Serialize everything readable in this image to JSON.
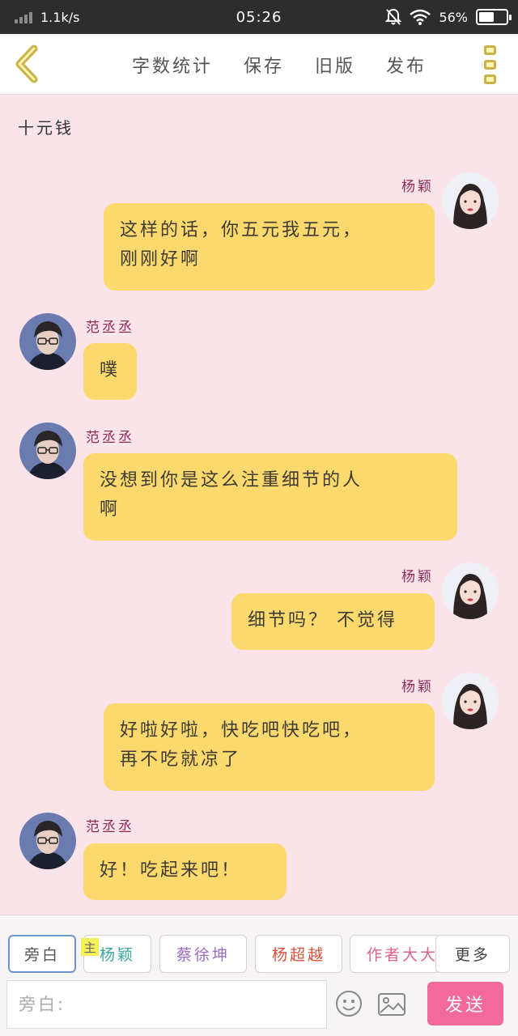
{
  "status_bar": {
    "speed": "1.1k/s",
    "time": "05:26",
    "battery": "56%",
    "battery_level": 0.56
  },
  "toolbar": {
    "actions": [
      "字数统计",
      "保存",
      "旧版",
      "发布"
    ]
  },
  "scene_text": "十元钱",
  "messages": [
    {
      "speaker": "杨颖",
      "side": "right",
      "text_lines": [
        "这样的话，你五元我五元，",
        "刚刚好啊"
      ]
    },
    {
      "speaker": "范丞丞",
      "side": "left",
      "text_lines": [
        "噗"
      ]
    },
    {
      "speaker": "范丞丞",
      "side": "left",
      "text_lines": [
        "没想到你是这么注重细节的人",
        "啊"
      ]
    },
    {
      "speaker": "杨颖",
      "side": "right",
      "text_lines": [
        "细节吗？ 不觉得"
      ]
    },
    {
      "speaker": "杨颖",
      "side": "right",
      "text_lines": [
        "好啦好啦，快吃吧快吃吧，",
        "再不吃就凉了"
      ]
    },
    {
      "speaker": "范丞丞",
      "side": "left",
      "text_lines": [
        "好！吃起来吧！"
      ]
    }
  ],
  "roles": [
    {
      "label": "旁白",
      "color": "#555555",
      "selected": true
    },
    {
      "label": "杨颖",
      "color": "#3aa89a",
      "selected": false,
      "badge": "主"
    },
    {
      "label": "蔡徐坤",
      "color": "#9b6bc7",
      "selected": false
    },
    {
      "label": "杨超越",
      "color": "#d9503a",
      "selected": false
    },
    {
      "label": "作者大大",
      "color": "#e05f8c",
      "selected": false
    },
    {
      "label": "更多",
      "color": "#444444",
      "selected": false
    }
  ],
  "input": {
    "placeholder": "旁白:"
  },
  "send_label": "发送",
  "colors": {
    "background": "#fbe3ea",
    "bubble": "#fcd96d",
    "name": "#8b2b54",
    "send_button": "#f3699b"
  }
}
